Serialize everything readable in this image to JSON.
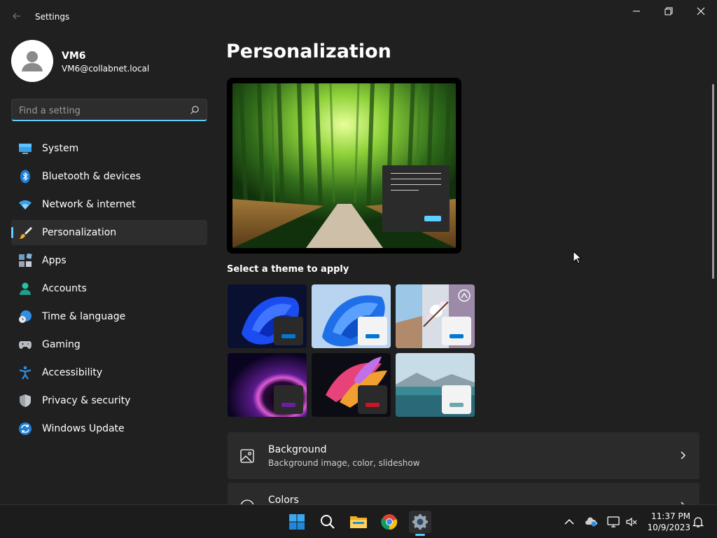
{
  "window": {
    "title": "Settings"
  },
  "profile": {
    "name": "VM6",
    "email": "VM6@collabnet.local"
  },
  "search": {
    "placeholder": "Find a setting",
    "value": ""
  },
  "sidebar": {
    "items": [
      {
        "label": "System",
        "icon": "system-icon"
      },
      {
        "label": "Bluetooth & devices",
        "icon": "bluetooth-icon"
      },
      {
        "label": "Network & internet",
        "icon": "wifi-icon"
      },
      {
        "label": "Personalization",
        "icon": "brush-icon",
        "selected": true
      },
      {
        "label": "Apps",
        "icon": "apps-icon"
      },
      {
        "label": "Accounts",
        "icon": "person-icon"
      },
      {
        "label": "Time & language",
        "icon": "globe-clock-icon"
      },
      {
        "label": "Gaming",
        "icon": "gamepad-icon"
      },
      {
        "label": "Accessibility",
        "icon": "accessibility-icon"
      },
      {
        "label": "Privacy & security",
        "icon": "shield-icon"
      },
      {
        "label": "Windows Update",
        "icon": "update-icon"
      }
    ]
  },
  "main": {
    "title": "Personalization",
    "themes_label": "Select a theme to apply",
    "themes": [
      {
        "name": "dark-bloom",
        "accent": "#0078d4"
      },
      {
        "name": "light-bloom",
        "accent": "#0078d4"
      },
      {
        "name": "blossom",
        "accent": "#0078d4"
      },
      {
        "name": "purple-glow",
        "accent": "#6b1fa3"
      },
      {
        "name": "captured-motion",
        "accent": "#d01324"
      },
      {
        "name": "lake",
        "accent": "#6aa8b0"
      }
    ],
    "cards": [
      {
        "title": "Background",
        "subtitle": "Background image, color, slideshow",
        "icon": "image-icon"
      },
      {
        "title": "Colors",
        "subtitle": "",
        "icon": "palette-icon"
      }
    ]
  },
  "taskbar": {
    "apps": [
      "start-icon",
      "search-icon",
      "file-explorer-icon",
      "chrome-icon",
      "settings-icon"
    ],
    "time": "11:37 PM",
    "date": "10/9/2023"
  },
  "colors": {
    "accent": "#60cdff",
    "background": "#202020",
    "card": "#2b2b2b"
  }
}
